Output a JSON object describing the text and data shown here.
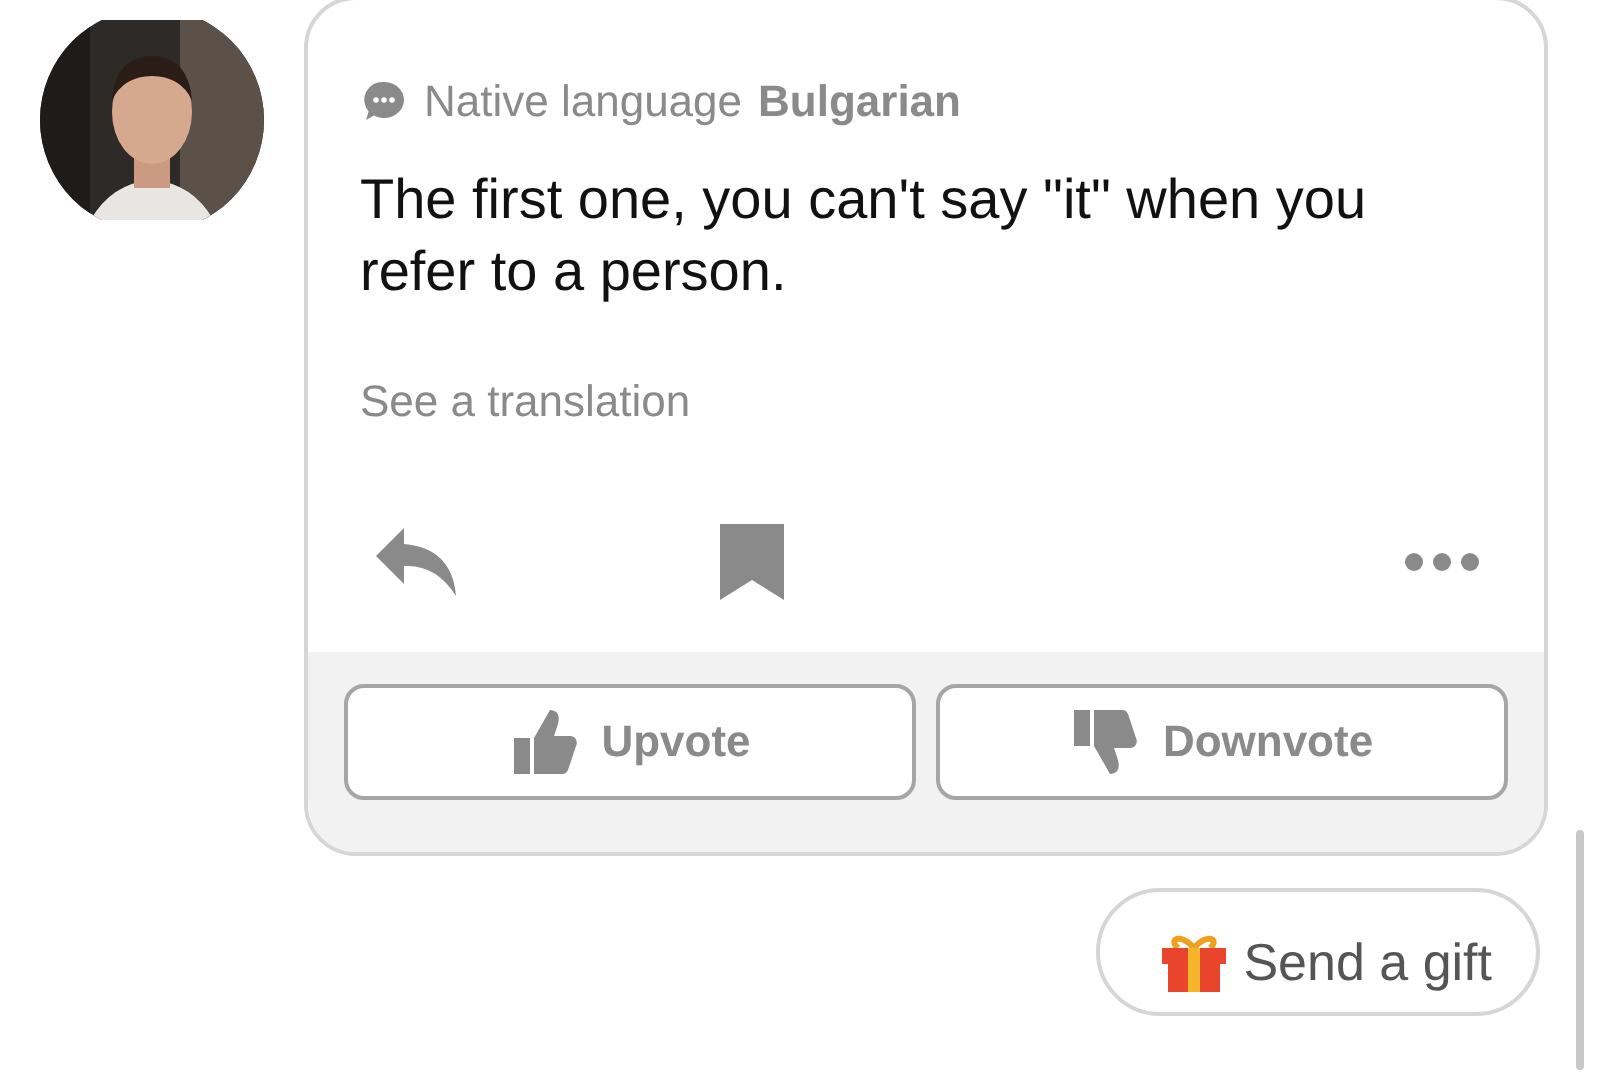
{
  "card": {
    "native_language_label": "Native language",
    "native_language": "Bulgarian",
    "text": "The first one, you can't say \"it\" when you refer to a person.",
    "translation_link": "See a translation",
    "votes": [
      {
        "kind": "up",
        "label": "Upvote"
      },
      {
        "kind": "down",
        "label": "Downvote"
      }
    ]
  },
  "gift_button": {
    "label": "Send a gift"
  }
}
